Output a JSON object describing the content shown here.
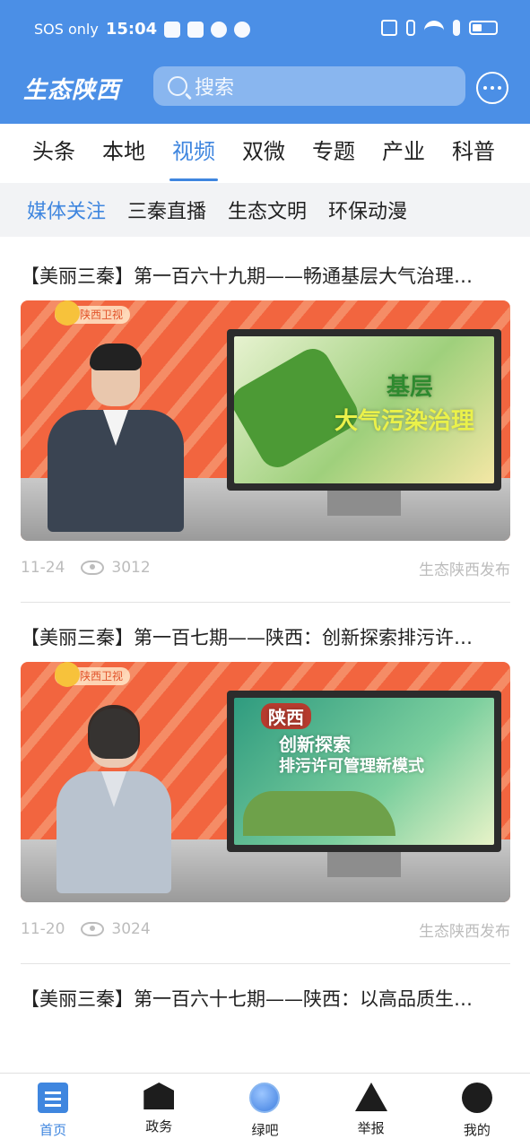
{
  "status": {
    "left_text": "SOS only",
    "time": "15:04"
  },
  "header": {
    "logo": "生态陕西",
    "search_placeholder": "搜索"
  },
  "tabs": [
    {
      "label": "头条",
      "active": false
    },
    {
      "label": "本地",
      "active": false
    },
    {
      "label": "视频",
      "active": true
    },
    {
      "label": "双微",
      "active": false
    },
    {
      "label": "专题",
      "active": false
    },
    {
      "label": "产业",
      "active": false
    },
    {
      "label": "科普",
      "active": false
    }
  ],
  "subtabs": [
    {
      "label": "媒体关注",
      "active": true
    },
    {
      "label": "三秦直播",
      "active": false
    },
    {
      "label": "生态文明",
      "active": false
    },
    {
      "label": "环保动漫",
      "active": false
    }
  ],
  "feed": [
    {
      "title": "【美丽三秦】第一百六十九期——畅通基层大气治理…",
      "thumb_badge": "陕西卫视",
      "screen_text_1": "基层",
      "screen_text_2": "大气污染治理",
      "date": "11-24",
      "views": "3012",
      "source": "生态陕西发布"
    },
    {
      "title": "【美丽三秦】第一百七期——陕西：创新探索排污许…",
      "thumb_badge": "陕西卫视",
      "screen_text_1": "陕西",
      "screen_text_2": "创新探索",
      "screen_text_3": "排污许可管理新模式",
      "date": "11-20",
      "views": "3024",
      "source": "生态陕西发布"
    },
    {
      "title": "【美丽三秦】第一百六十七期——陕西：以高品质生…"
    }
  ],
  "bottom_nav": [
    {
      "label": "首页",
      "icon": "home-icon",
      "active": true
    },
    {
      "label": "政务",
      "icon": "government-icon",
      "active": false
    },
    {
      "label": "绿吧",
      "icon": "green-bar-icon",
      "active": false
    },
    {
      "label": "举报",
      "icon": "report-icon",
      "active": false
    },
    {
      "label": "我的",
      "icon": "profile-icon",
      "active": false
    }
  ],
  "colors": {
    "brand": "#4b8fe6",
    "accent": "#3f86df"
  }
}
